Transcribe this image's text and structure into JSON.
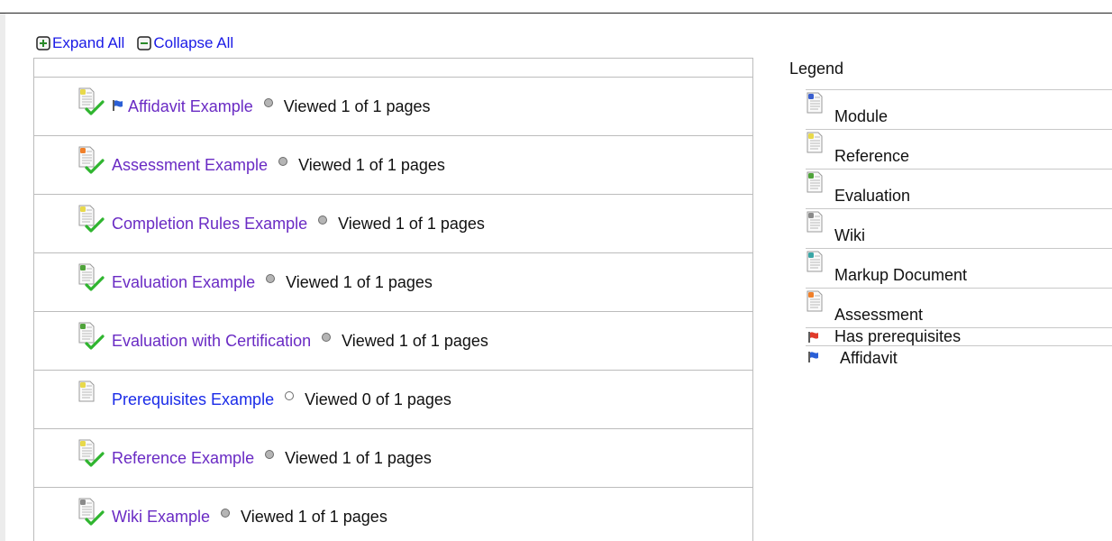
{
  "toolbar": {
    "expand_label": "Expand All",
    "collapse_label": "Collapse All"
  },
  "items": [
    {
      "title": "Affidavit Example",
      "status": "Viewed 1 of 1 pages",
      "doc_color": "#e8d94a",
      "checked": true,
      "affidavit_flag": true,
      "visited": true,
      "dot_filled": true
    },
    {
      "title": "Assessment Example",
      "status": "Viewed 1 of 1 pages",
      "doc_color": "#f0802a",
      "checked": true,
      "affidavit_flag": false,
      "visited": true,
      "dot_filled": true
    },
    {
      "title": "Completion Rules Example",
      "status": "Viewed 1 of 1 pages",
      "doc_color": "#e8d94a",
      "checked": true,
      "affidavit_flag": false,
      "visited": true,
      "dot_filled": true
    },
    {
      "title": "Evaluation Example",
      "status": "Viewed 1 of 1 pages",
      "doc_color": "#4fa33a",
      "checked": true,
      "affidavit_flag": false,
      "visited": true,
      "dot_filled": true
    },
    {
      "title": "Evaluation with Certification",
      "status": "Viewed 1 of 1 pages",
      "doc_color": "#4fa33a",
      "checked": true,
      "affidavit_flag": false,
      "visited": true,
      "dot_filled": true
    },
    {
      "title": "Prerequisites Example",
      "status": "Viewed 0 of 1 pages",
      "doc_color": "#e8d94a",
      "checked": false,
      "affidavit_flag": false,
      "visited": false,
      "dot_filled": false
    },
    {
      "title": "Reference Example",
      "status": "Viewed 1 of 1 pages",
      "doc_color": "#e8d94a",
      "checked": true,
      "affidavit_flag": false,
      "visited": true,
      "dot_filled": true
    },
    {
      "title": "Wiki Example",
      "status": "Viewed 1 of 1 pages",
      "doc_color": "#8a8a8a",
      "checked": true,
      "affidavit_flag": false,
      "visited": true,
      "dot_filled": true
    }
  ],
  "legend": {
    "title": "Legend",
    "items": [
      {
        "label": "Module",
        "icon": "doc-blue-icon",
        "color": "#3a5fcf"
      },
      {
        "label": "Reference",
        "icon": "doc-yellow-icon",
        "color": "#e8d94a"
      },
      {
        "label": "Evaluation",
        "icon": "doc-green-icon",
        "color": "#4fa33a"
      },
      {
        "label": "Wiki",
        "icon": "doc-gray-icon",
        "color": "#8a8a8a"
      },
      {
        "label": "Markup Document",
        "icon": "doc-teal-icon",
        "color": "#3aa6a6"
      },
      {
        "label": "Assessment",
        "icon": "doc-orange-icon",
        "color": "#f0802a"
      },
      {
        "label": "Has prerequisites",
        "icon": "red-flag-icon",
        "color": "#e03a2a"
      },
      {
        "label": "Affidavit",
        "icon": "blue-flag-icon",
        "color": "#2a5fd6"
      }
    ]
  },
  "colors": {
    "link_visited": "#6a2bc4",
    "link_unvisited": "#1a2be8",
    "check_green": "#2fb52f"
  }
}
